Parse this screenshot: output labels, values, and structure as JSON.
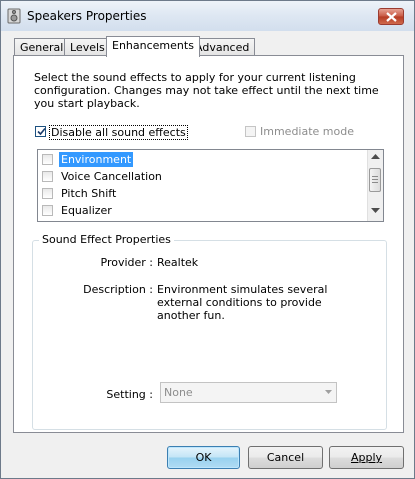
{
  "window": {
    "title": "Speakers Properties"
  },
  "tabs": [
    {
      "label": "General",
      "active": false
    },
    {
      "label": "Levels",
      "active": false
    },
    {
      "label": "Enhancements",
      "active": true
    },
    {
      "label": "Advanced",
      "active": false
    }
  ],
  "enhancements": {
    "intro": "Select the sound effects to apply for your current listening configuration. Changes may not take effect until the next time you start playback.",
    "disable_all": {
      "label": "Disable all sound effects",
      "checked": true
    },
    "immediate_mode": {
      "label": "Immediate mode",
      "checked": false,
      "enabled": false
    },
    "effects": [
      {
        "label": "Environment",
        "checked": false,
        "selected": true
      },
      {
        "label": "Voice Cancellation",
        "checked": false,
        "selected": false
      },
      {
        "label": "Pitch Shift",
        "checked": false,
        "selected": false
      },
      {
        "label": "Equalizer",
        "checked": false,
        "selected": false
      }
    ],
    "properties": {
      "title": "Sound Effect Properties",
      "provider_label": "Provider :",
      "provider_value": "Realtek",
      "description_label": "Description :",
      "description_value": "Environment simulates several external conditions to provide another fun.",
      "setting_label": "Setting :",
      "setting_value": "None"
    }
  },
  "buttons": {
    "ok": "OK",
    "cancel": "Cancel",
    "apply": "Apply"
  },
  "colors": {
    "selection": "#3399ff",
    "window_bg": "#f0f0f0",
    "close_button": "#c85a45"
  }
}
